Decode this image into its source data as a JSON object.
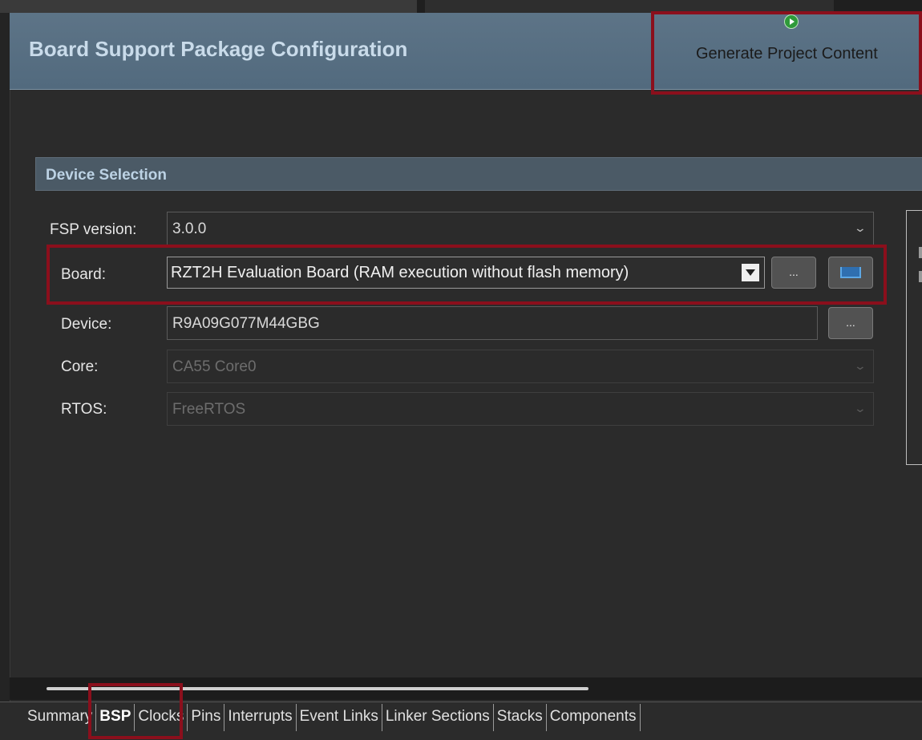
{
  "header": {
    "title": "Board Support Package Configuration",
    "generate_button": {
      "label": "Generate Project Content",
      "icon": "play-circle-icon"
    }
  },
  "device_selection": {
    "title": "Device Selection",
    "fields": {
      "fsp_version": {
        "label": "FSP version:",
        "value": "3.0.0"
      },
      "board": {
        "label": "Board:",
        "value": "RZT2H Evaluation Board (RAM execution without flash memory)",
        "browse_label": "...",
        "import_icon": "import-board-icon"
      },
      "device": {
        "label": "Device:",
        "value": "R9A09G077M44GBG",
        "browse_label": "..."
      },
      "core": {
        "label": "Core:",
        "value": "CA55 Core0"
      },
      "rtos": {
        "label": "RTOS:",
        "value": "FreeRTOS"
      }
    }
  },
  "tabs": [
    {
      "label": "Summary"
    },
    {
      "label": "BSP"
    },
    {
      "label": "Clocks"
    },
    {
      "label": "Pins"
    },
    {
      "label": "Interrupts"
    },
    {
      "label": "Event Links"
    },
    {
      "label": "Linker Sections"
    },
    {
      "label": "Stacks"
    },
    {
      "label": "Components"
    }
  ],
  "active_tab": "BSP",
  "colors": {
    "highlight": "#8b0f1c",
    "header_bg": "#5d7487",
    "section_bg": "#4b5a66"
  }
}
